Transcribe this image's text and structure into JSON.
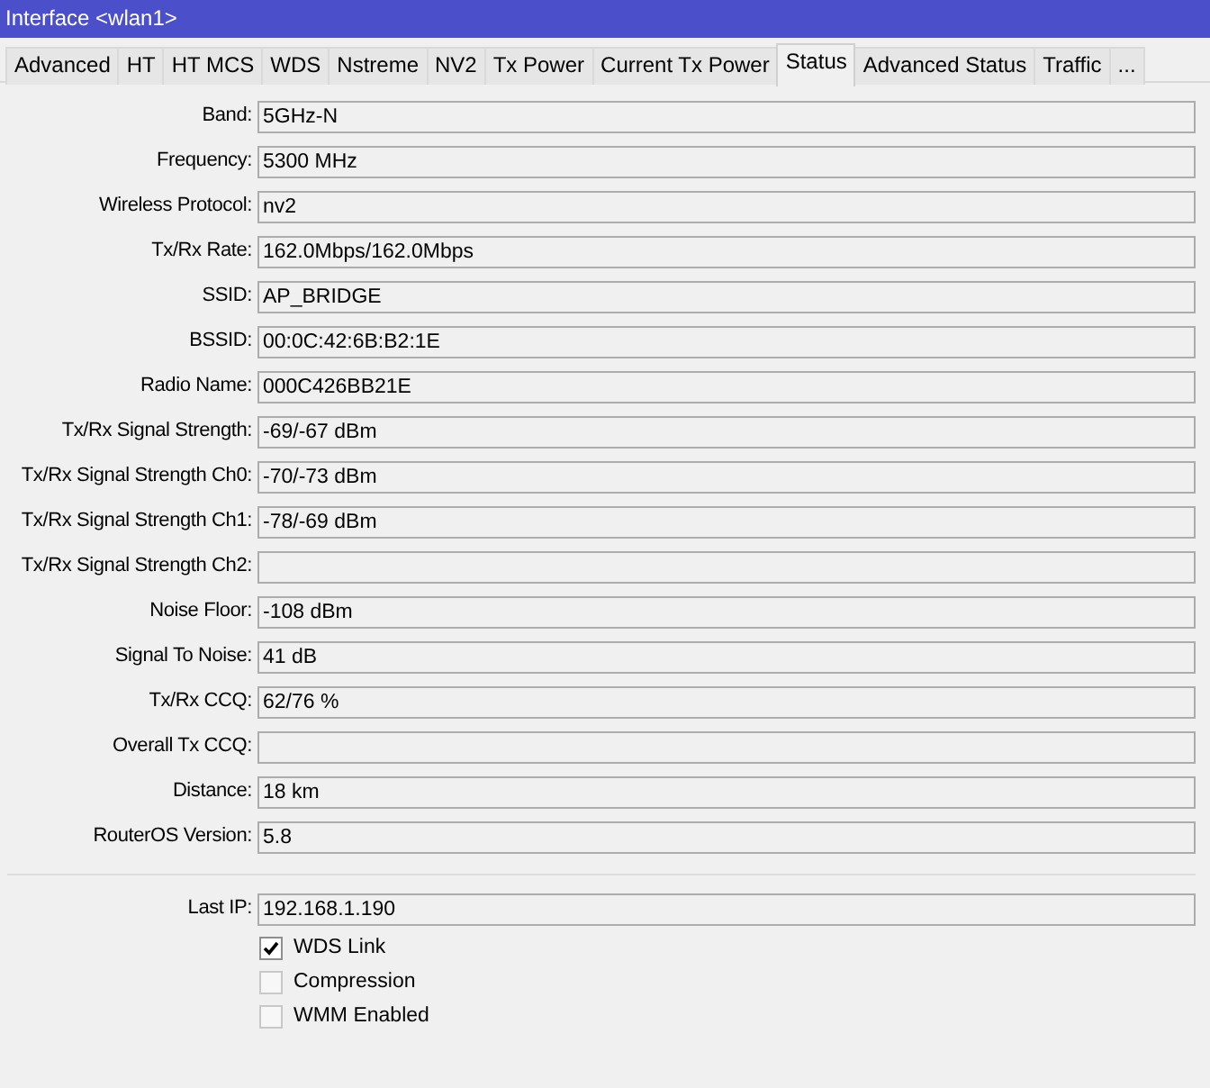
{
  "window": {
    "title": "Interface <wlan1>"
  },
  "tabs": [
    {
      "label": "Advanced",
      "selected": false
    },
    {
      "label": "HT",
      "selected": false
    },
    {
      "label": "HT MCS",
      "selected": false
    },
    {
      "label": "WDS",
      "selected": false
    },
    {
      "label": "Nstreme",
      "selected": false
    },
    {
      "label": "NV2",
      "selected": false
    },
    {
      "label": "Tx Power",
      "selected": false
    },
    {
      "label": "Current Tx Power",
      "selected": false
    },
    {
      "label": "Status",
      "selected": true
    },
    {
      "label": "Advanced Status",
      "selected": false
    },
    {
      "label": "Traffic",
      "selected": false
    },
    {
      "label": "...",
      "selected": false
    }
  ],
  "fields": [
    {
      "label": "Band:",
      "value": "5GHz-N"
    },
    {
      "label": "Frequency:",
      "value": "5300 MHz"
    },
    {
      "label": "Wireless Protocol:",
      "value": "nv2"
    },
    {
      "label": "Tx/Rx Rate:",
      "value": "162.0Mbps/162.0Mbps"
    },
    {
      "label": "SSID:",
      "value": "AP_BRIDGE"
    },
    {
      "label": "BSSID:",
      "value": "00:0C:42:6B:B2:1E"
    },
    {
      "label": "Radio Name:",
      "value": "000C426BB21E"
    },
    {
      "label": "Tx/Rx Signal Strength:",
      "value": "-69/-67 dBm"
    },
    {
      "label": "Tx/Rx Signal Strength Ch0:",
      "value": "-70/-73 dBm"
    },
    {
      "label": "Tx/Rx Signal Strength Ch1:",
      "value": "-78/-69 dBm"
    },
    {
      "label": "Tx/Rx Signal Strength Ch2:"
    },
    {
      "label": "Noise Floor:",
      "value": "-108 dBm"
    },
    {
      "label": "Signal To Noise:",
      "value": "41 dB"
    },
    {
      "label": "Tx/Rx CCQ:",
      "value": "62/76 %"
    },
    {
      "label": "Overall Tx CCQ:"
    },
    {
      "label": "Distance:",
      "value": "18 km"
    },
    {
      "label": "RouterOS Version:",
      "value": "5.8"
    }
  ],
  "after_separator": [
    {
      "label": "Last IP:",
      "value": "192.168.1.190"
    }
  ],
  "checkboxes": [
    {
      "label": "WDS Link",
      "checked": true
    },
    {
      "label": "Compression",
      "checked": false
    },
    {
      "label": "WMM Enabled",
      "checked": false
    }
  ]
}
